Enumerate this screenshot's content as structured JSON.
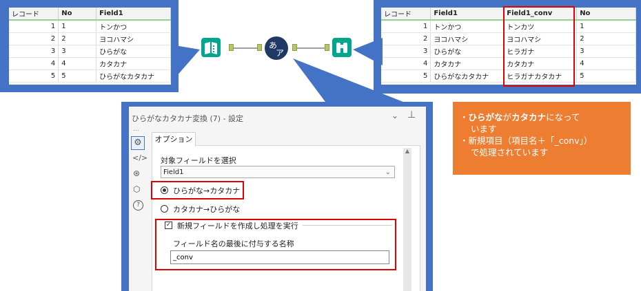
{
  "input_table": {
    "headers": [
      "レコード",
      "No",
      "Field1"
    ],
    "rows": [
      [
        "1",
        "1",
        "トンかつ"
      ],
      [
        "2",
        "2",
        "ヨコハマシ"
      ],
      [
        "3",
        "3",
        "ひらがな"
      ],
      [
        "4",
        "4",
        "カタカナ"
      ],
      [
        "5",
        "5",
        "ひらがなカタカナ"
      ]
    ]
  },
  "output_table": {
    "headers": [
      "レコード",
      "Field1",
      "Field1_conv",
      "No"
    ],
    "rows": [
      [
        "1",
        "トンかつ",
        "トンカツ",
        "1"
      ],
      [
        "2",
        "ヨコハマシ",
        "ヨコハマシ",
        "2"
      ],
      [
        "3",
        "ひらがな",
        "ヒラガナ",
        "3"
      ],
      [
        "4",
        "カタカナ",
        "カタカナ",
        "4"
      ],
      [
        "5",
        "ひらがなカタカナ",
        "ヒラガナカタカナ",
        "5"
      ]
    ]
  },
  "workflow": {
    "input_icon": "book-icon",
    "convert_icon": "kana-convert-icon",
    "browse_icon": "binoculars-icon",
    "convert_glyph_top": "あ",
    "convert_glyph_bottom": "ア",
    "accent_color": "#00a58e",
    "convert_color": "#1f3864"
  },
  "panel": {
    "title": "ひらがなカタカナ変換 (7) - 設定",
    "tab_label": "オプション",
    "field_select_label": "対象フィールドを選択",
    "field_selected": "Field1",
    "radio_hira_to_kata": "ひらがな→カタカナ",
    "radio_kata_to_hira": "カタカナ→ひらがな",
    "checkbox_label": "新規フィールドを作成し処理を実行",
    "suffix_label": "フィールド名の最後に付与する名称",
    "suffix_value": "_conv",
    "ellipsis": "..."
  },
  "callout": {
    "line1_bold1": "ひらがな",
    "line1_mid": "が",
    "line1_bold2": "カタカナ",
    "line1_end": "になって",
    "line2": "います",
    "line3": "・新規項目（項目名＋「_conv」）",
    "line4": "で処理されています",
    "bullet": "・",
    "color": "#ed7d31"
  }
}
